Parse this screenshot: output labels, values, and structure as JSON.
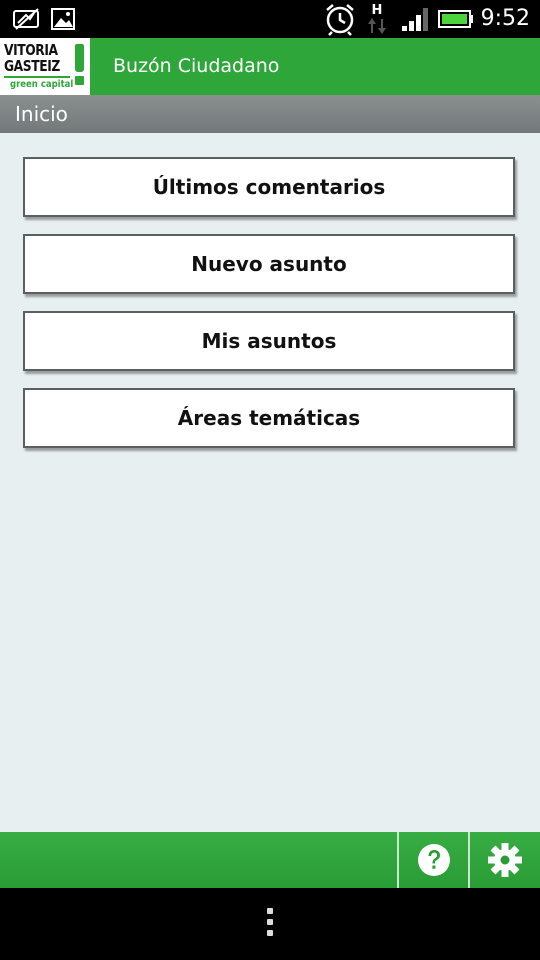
{
  "status_bar": {
    "time": "9:52",
    "network_type": "H",
    "icons": [
      "signal-off-icon",
      "gallery-icon",
      "alarm-icon",
      "data-transfer-icon",
      "signal-bars-icon",
      "battery-icon"
    ]
  },
  "header": {
    "logo": {
      "line1": "VITORIA",
      "line2": "GASTEIZ",
      "line3": "green capital"
    },
    "title": "Buzón Ciudadano",
    "accent_color": "#2ea63a"
  },
  "breadcrumb": {
    "label": "Inicio"
  },
  "menu": {
    "items": [
      {
        "label": "Últimos comentarios"
      },
      {
        "label": "Nuevo asunto"
      },
      {
        "label": "Mis asuntos"
      },
      {
        "label": "Áreas temáticas"
      }
    ]
  },
  "bottom_bar": {
    "help_icon": "help-icon",
    "settings_icon": "gear-icon"
  },
  "nav_bar": {
    "menu_icon": "overflow-menu-icon"
  }
}
